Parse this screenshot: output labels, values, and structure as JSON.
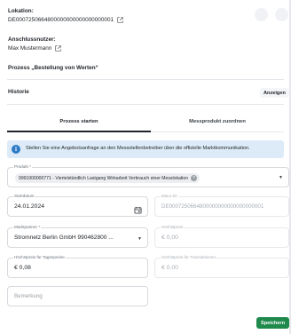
{
  "header": {
    "lokation_label": "Lokation:",
    "lokation_value": "DE0007250664800000000000000000001",
    "nutzer_label": "Anschlussnutzer:",
    "nutzer_value": "Max Mustermann"
  },
  "prozess_title": "Prozess „Bestellung von Werten“",
  "historie": {
    "title": "Historie",
    "button_label": "Anzeigen"
  },
  "tabs": [
    {
      "label": "Prozess starten",
      "active": true
    },
    {
      "label": "Messprodukt zuordnen",
      "active": false
    }
  ],
  "info": {
    "text": "Stellen Sie eine Angebotsanfrage an den Messstellenbetreiber über die offizielle Marktkommunikation."
  },
  "form": {
    "produkt": {
      "label": "Produkt *",
      "chip": "9991000000771 - Viertelstündlich Lastgang Wirkarbeit Verbrauch einer Messlokation"
    },
    "startdatum": {
      "label": "Startdatum",
      "value": "24.01.2024"
    },
    "malo_id": {
      "label": "MaLo-ID",
      "value": "DE0007250664800000000000000000001"
    },
    "marktpartner": {
      "label": "Marktpartner *",
      "value": "Stromnetz Berlin GmbH 990462800 ..."
    },
    "hoechstpreis": {
      "label": "Höchstpreis",
      "value": "€ 0,00"
    },
    "hoechstpreis_tages": {
      "label": "Höchstpreis für Tagespreise",
      "value": "€ 0,08"
    },
    "hoechstpreis_trans": {
      "label": "Höchstpreis für Transaktionen",
      "value": "€ 0,00"
    },
    "bemerkung": {
      "placeholder": "Bemerkung"
    }
  },
  "actions": {
    "save_label": "Speichern"
  },
  "colors": {
    "primary_green": "#1f8a4c",
    "info_blue": "#2e7cc7",
    "info_bg": "#dcebf7"
  },
  "icons": [
    "external-link-icon",
    "info-icon",
    "calendar-icon",
    "chevron-down-icon",
    "chip-remove-icon"
  ]
}
